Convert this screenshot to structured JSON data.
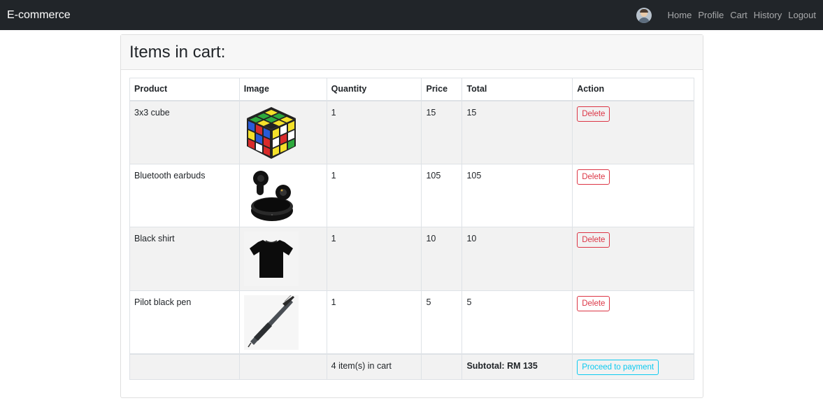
{
  "navbar": {
    "brand": "E-commerce",
    "links": [
      "Home",
      "Profile",
      "Cart",
      "History",
      "Logout"
    ]
  },
  "page": {
    "title": "Items in cart:"
  },
  "table": {
    "headers": [
      "Product",
      "Image",
      "Quantity",
      "Price",
      "Total",
      "Action"
    ],
    "rows": [
      {
        "product": "3x3 cube",
        "image": "rubiks-cube-image",
        "quantity": "1",
        "price": "15",
        "total": "15",
        "action": "Delete"
      },
      {
        "product": "Bluetooth earbuds",
        "image": "earbuds-image",
        "quantity": "1",
        "price": "105",
        "total": "105",
        "action": "Delete"
      },
      {
        "product": "Black shirt",
        "image": "black-shirt-image",
        "quantity": "1",
        "price": "10",
        "total": "10",
        "action": "Delete"
      },
      {
        "product": "Pilot black pen",
        "image": "pen-image",
        "quantity": "1",
        "price": "5",
        "total": "5",
        "action": "Delete"
      }
    ],
    "footer": {
      "items_count": "4 item(s) in cart",
      "subtotal": "Subtotal: RM 135",
      "pay_label": "Proceed to payment"
    }
  },
  "colors": {
    "navbar": "#212529",
    "danger": "#dc3545",
    "info": "#0dcaf0"
  }
}
